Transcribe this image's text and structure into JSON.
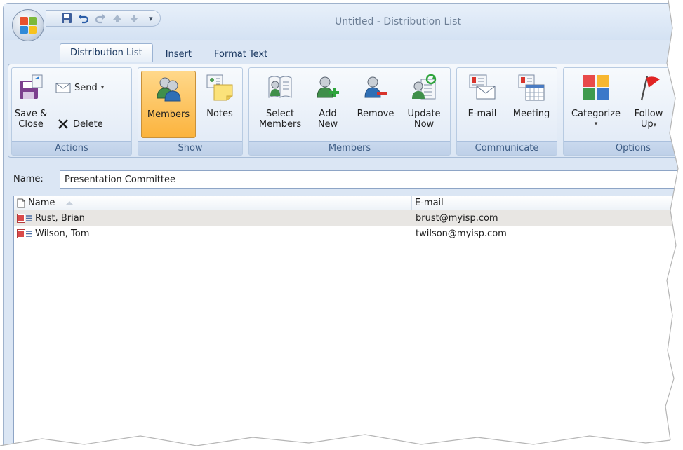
{
  "window": {
    "title": "Untitled - Distribution List"
  },
  "qat": {
    "icons": [
      "save-icon",
      "undo-icon",
      "redo-icon",
      "up-arrow-icon",
      "down-arrow-icon"
    ],
    "more": "▾"
  },
  "tabs": [
    {
      "label": "Distribution List",
      "active": true
    },
    {
      "label": "Insert",
      "active": false
    },
    {
      "label": "Format Text",
      "active": false
    }
  ],
  "ribbon": {
    "actions": {
      "label": "Actions",
      "save_close_1": "Save &",
      "save_close_2": "Close",
      "send": "Send",
      "delete": "Delete"
    },
    "show": {
      "label": "Show",
      "members": "Members",
      "notes": "Notes"
    },
    "members": {
      "label": "Members",
      "select_1": "Select",
      "select_2": "Members",
      "add_1": "Add",
      "add_2": "New",
      "remove": "Remove",
      "update_1": "Update",
      "update_2": "Now"
    },
    "communicate": {
      "label": "Communicate",
      "email": "E-mail",
      "meeting": "Meeting"
    },
    "options": {
      "label": "Options",
      "categorize": "Categorize",
      "follow_1": "Follow",
      "follow_2": "Up"
    }
  },
  "name_field": {
    "label": "Name:",
    "value": "Presentation Committee"
  },
  "list": {
    "columns": {
      "name": "Name",
      "email": "E-mail"
    },
    "rows": [
      {
        "name": "Rust, Brian",
        "email": "brust@myisp.com",
        "selected": true
      },
      {
        "name": "Wilson, Tom",
        "email": "twilson@myisp.com",
        "selected": false
      }
    ]
  },
  "colors": {
    "pressed": "#fbb33d",
    "ribbon_label": "#3e5d85",
    "accent_blue": "#17355e"
  }
}
